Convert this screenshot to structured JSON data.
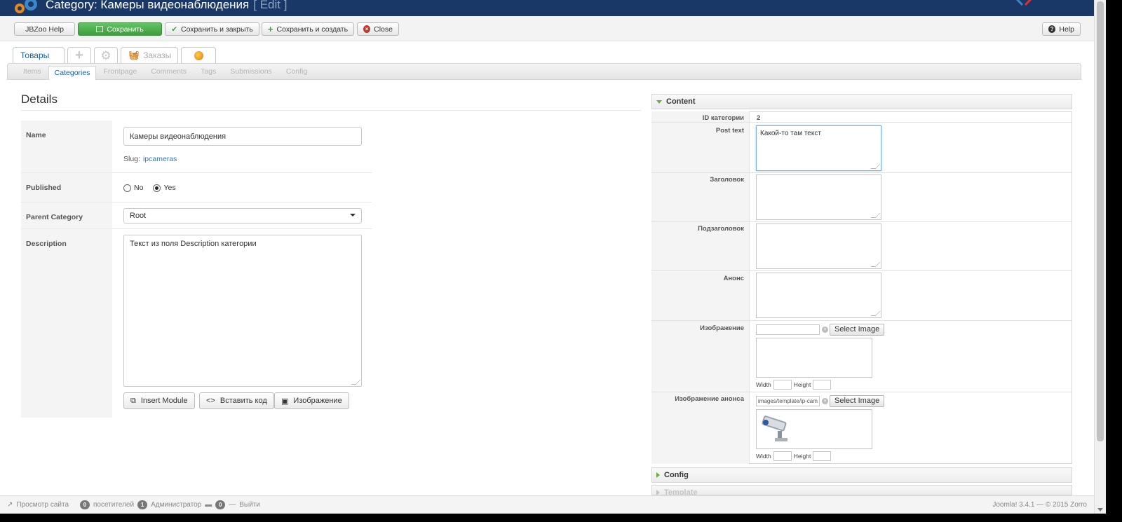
{
  "header": {
    "title": "Category: Камеры видеонаблюдения",
    "edit": "[ Edit ]"
  },
  "toolbar": {
    "jbzoo_help": "JBZoo Help",
    "save": "Сохранить",
    "save_close": "Сохранить и закрыть",
    "save_new": "Сохранить и создать",
    "close": "Close",
    "help": "Help"
  },
  "tabs": {
    "items": "Товары",
    "orders": "Заказы"
  },
  "subnav": [
    "Items",
    "Categories",
    "Frontpage",
    "Comments",
    "Tags",
    "Submissions",
    "Config"
  ],
  "details": {
    "title": "Details",
    "name_label": "Name",
    "name_value": "Камеры видеонаблюдения",
    "slug_label": "Slug:",
    "slug_value": "ipcameras",
    "published_label": "Published",
    "published_no": "No",
    "published_yes": "Yes",
    "parent_label": "Parent Category",
    "parent_value": "Root",
    "description_label": "Description",
    "description_value": "Текст из поля Description категории",
    "btn_insert_module": "Insert Module",
    "btn_insert_code": "Вставить код",
    "btn_image": "Изображение"
  },
  "content": {
    "header": "Content",
    "id_label": "ID категории",
    "id_value": "2",
    "post_text_label": "Post text",
    "post_text_value": "Какой-то там текст",
    "heading_label": "Заголовок",
    "subheading_label": "Подзаголовок",
    "announce_label": "Анонс",
    "image_label": "Изображение",
    "image_announce_label": "Изображение анонса",
    "image_announce_path": "images/template/ip-cam",
    "select_image": "Select Image",
    "width_label": "Width",
    "height_label": "Height"
  },
  "accordion": {
    "config": "Config",
    "template": "Template"
  },
  "statusbar": {
    "view_site": "Просмотр сайта",
    "visitors_count": "0",
    "visitors": "посетителей",
    "admin_count": "1",
    "admin": "Администратор",
    "messages_count": "0",
    "logout": "Выйти",
    "version": "Joomla! 3.4.1 — © 2015 Zorro"
  }
}
